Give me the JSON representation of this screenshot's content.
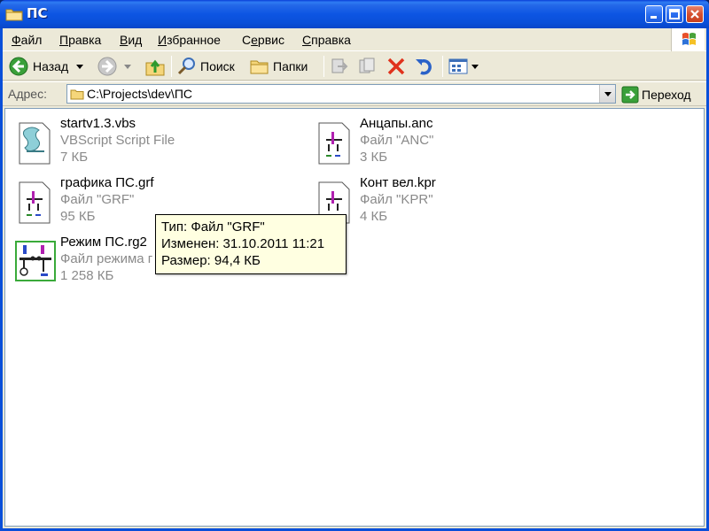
{
  "window": {
    "title": "ПС"
  },
  "menu": {
    "items": [
      {
        "label": "Файл",
        "mnemonic": "Ф"
      },
      {
        "label": "Правка",
        "mnemonic": "П"
      },
      {
        "label": "Вид",
        "mnemonic": "В"
      },
      {
        "label": "Избранное",
        "mnemonic": "И"
      },
      {
        "label": "Сервис",
        "mnemonic": "е"
      },
      {
        "label": "Справка",
        "mnemonic": "С"
      }
    ]
  },
  "toolbar": {
    "back_label": "Назад",
    "search_label": "Поиск",
    "folders_label": "Папки"
  },
  "address": {
    "label": "Адрес:",
    "path": "C:\\Projects\\dev\\ПС",
    "go_label": "Переход"
  },
  "files": [
    {
      "name": "startv1.3.vbs",
      "type": "VBScript Script File",
      "size": "7 КБ",
      "icon": "vbscript-file-icon"
    },
    {
      "name": "Анцапы.anc",
      "type": "Файл \"ANC\"",
      "size": "3 КБ",
      "icon": "generic-file-icon"
    },
    {
      "name": "графика ПС.grf",
      "type": "Файл \"GRF\"",
      "size": "95 КБ",
      "icon": "generic-file-icon"
    },
    {
      "name": "Конт вел.kpr",
      "type": "Файл \"KPR\"",
      "size": "4 КБ",
      "icon": "generic-file-icon"
    },
    {
      "name": "Режим ПС.rg2",
      "type": "Файл режима г",
      "size": "1 258 КБ",
      "icon": "regime-file-icon"
    }
  ],
  "tooltip": {
    "line1": "Тип: Файл \"GRF\"",
    "line2": "Изменен: 31.10.2011 11:21",
    "line3": "Размер: 94,4 КБ"
  },
  "colors": {
    "titlebar": "#0a4fd9",
    "window_bg": "#ece9d8",
    "tooltip_bg": "#ffffe1",
    "secondary_text": "#8a8a8a"
  }
}
